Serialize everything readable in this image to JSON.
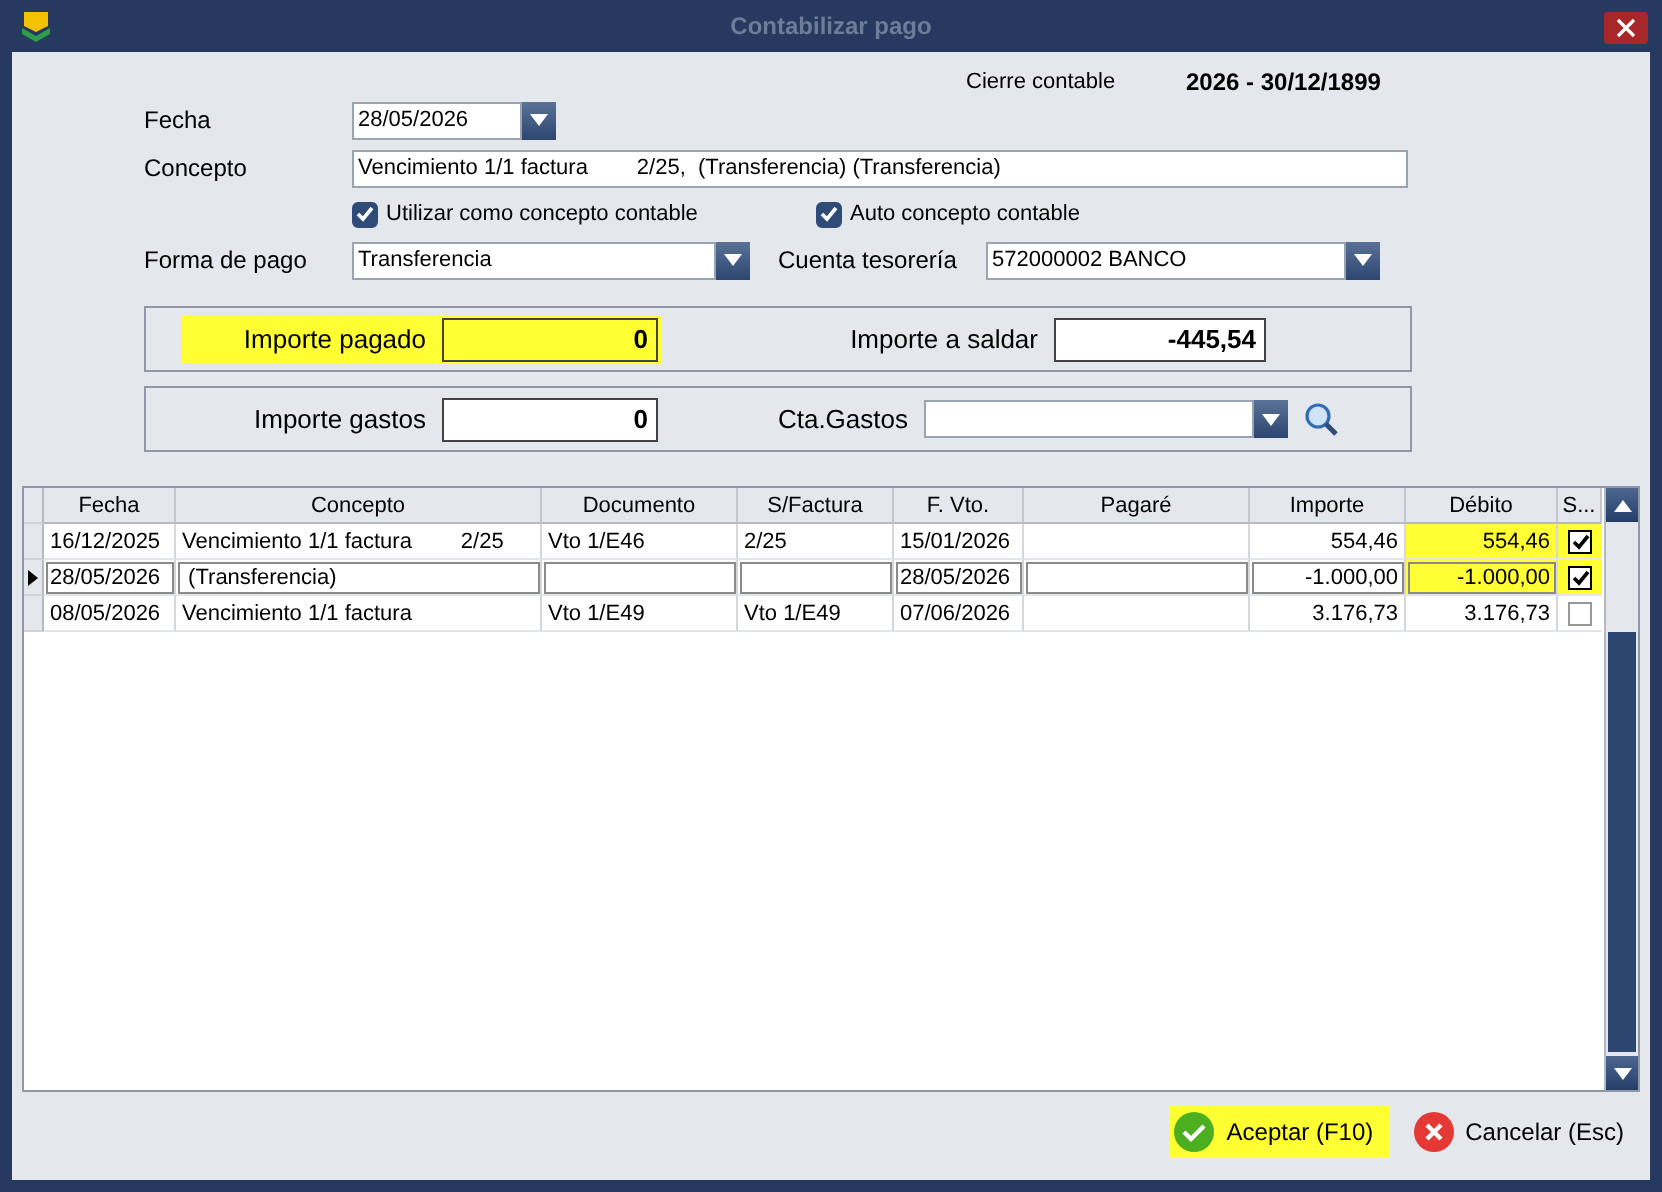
{
  "window": {
    "title": "Contabilizar pago"
  },
  "cierre": {
    "label": "Cierre contable",
    "value": "2026 - 30/12/1899"
  },
  "fecha": {
    "label": "Fecha",
    "value": "28/05/2026"
  },
  "concepto": {
    "label": "Concepto",
    "value": "Vencimiento 1/1 factura        2/25,  (Transferencia) (Transferencia)"
  },
  "checkboxes": [
    {
      "label": "Utilizar como concepto contable",
      "checked": true
    },
    {
      "label": "Auto concepto contable",
      "checked": true
    }
  ],
  "forma_pago": {
    "label": "Forma de pago",
    "value": "Transferencia"
  },
  "cuenta_tesoreria": {
    "label": "Cuenta tesorería",
    "value": "572000002 BANCO"
  },
  "importe_pagado": {
    "label": "Importe pagado",
    "value": "0",
    "highlighted": true
  },
  "importe_saldar": {
    "label": "Importe a saldar",
    "value": "-445,54"
  },
  "importe_gastos": {
    "label": "Importe gastos",
    "value": "0"
  },
  "cta_gastos": {
    "label": "Cta.Gastos"
  },
  "table": {
    "columns": [
      "Fecha",
      "Concepto",
      "Documento",
      "S/Factura",
      "F. Vto.",
      "Pagaré",
      "Importe",
      "Débito",
      "S..."
    ],
    "rows": [
      {
        "selected": false,
        "cells": [
          "16/12/2025",
          "Vencimiento 1/1 factura        2/25",
          "Vto 1/E46",
          "2/25",
          "15/01/2026",
          "",
          "554,46",
          "554,46"
        ],
        "highlighted": true,
        "checked": true
      },
      {
        "selected": true,
        "cells": [
          "28/05/2026",
          " (Transferencia)",
          "",
          "",
          "28/05/2026",
          "",
          "-1.000,00",
          "-1.000,00"
        ],
        "highlighted": true,
        "checked": true
      },
      {
        "selected": false,
        "cells": [
          "08/05/2026",
          "Vencimiento 1/1 factura",
          "Vto 1/E49",
          "Vto 1/E49",
          "07/06/2026",
          "",
          "3.176,73",
          "3.176,73"
        ],
        "highlighted": false,
        "checked": false
      }
    ]
  },
  "buttons": [
    {
      "kind": "accept",
      "label": "Aceptar (F10)",
      "highlighted": true
    },
    {
      "kind": "cancel",
      "label": "Cancelar (Esc)",
      "highlighted": false
    }
  ]
}
